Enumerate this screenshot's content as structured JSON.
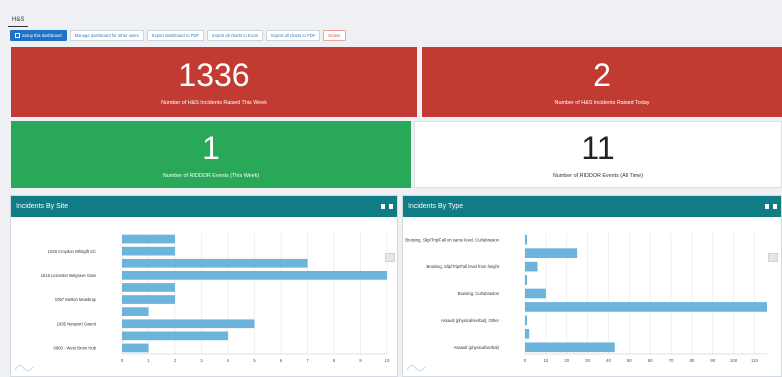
{
  "tabs": [
    {
      "label": "H&S"
    }
  ],
  "toolbar": {
    "setup_label": "Setup this dashboard",
    "manage_label": "Manage dashboard for other users",
    "export_pdf_label": "Export dashboard to PDF",
    "export_excel_label": "Export all charts to Excel",
    "export_charts_pdf_label": "Export all charts to PDF",
    "delete_label": "Delete"
  },
  "tiles": {
    "week_incidents": {
      "value": "1336",
      "label": "Number of H&S Incidents Raised This Week"
    },
    "today_incidents": {
      "value": "2",
      "label": "Number of H&S Incidents Raised Today"
    },
    "riddor_week": {
      "value": "1",
      "label": "Number of RIDDOR Events (This Week)"
    },
    "riddor_all": {
      "value": "11",
      "label": "Number of RIDDOR Events (All Time)"
    }
  },
  "panels": {
    "by_site": {
      "title": "Incidents By Site"
    },
    "by_type": {
      "title": "Incidents By Type"
    }
  },
  "colors": {
    "red": "#c23b32",
    "green": "#2aa85a",
    "teal": "#0f7c86",
    "bar": "#6cb4dc",
    "primary": "#1f73c6"
  },
  "chart_data": [
    {
      "type": "bar",
      "orientation": "horizontal",
      "title": "Incidents By Site",
      "categories": [
        "",
        "1029 Croydon Whitgift SC",
        "",
        "1515 Leicester Belgrave Gate",
        "",
        "1057 Melton Mowbray",
        "",
        "1935 Newport Gwent",
        "",
        "0900 - West Brom Hub"
      ],
      "values": [
        2,
        2,
        7,
        10,
        2,
        2,
        1,
        5,
        4,
        1
      ],
      "xlim": [
        0,
        10
      ],
      "xticks": [
        0,
        1,
        2,
        3,
        4,
        5,
        6,
        7,
        8,
        9,
        10
      ],
      "grid": true
    },
    {
      "type": "bar",
      "orientation": "horizontal",
      "title": "Incidents By Type",
      "categories": [
        "Bruising, Slip/Trip/Fall on same level, Cut/abrasion",
        "",
        "Bruising, Slip/Trip/Fall level from height",
        "",
        "Bruising, Cut/abrasion",
        "",
        "Assault (physical/verbal), Other",
        "",
        "Assault (physical/verbal)"
      ],
      "values": [
        1,
        25,
        6,
        1,
        10,
        116,
        1,
        2,
        43
      ],
      "xlim": [
        0,
        116
      ],
      "xticks": [
        0,
        10,
        20,
        30,
        40,
        50,
        60,
        70,
        80,
        90,
        100,
        110
      ],
      "grid": true
    }
  ]
}
